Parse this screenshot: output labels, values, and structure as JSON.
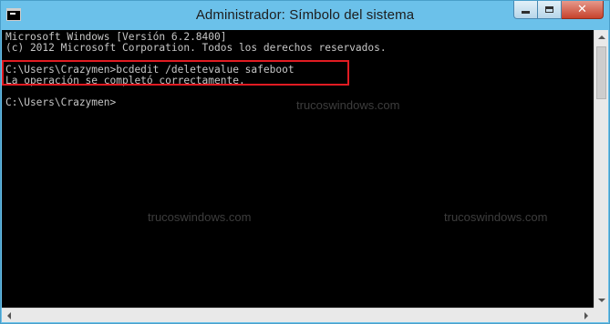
{
  "window": {
    "title": "Administrador: Símbolo del sistema",
    "app_icon": "cmd-icon",
    "controls": {
      "minimize_icon": "minimize-icon",
      "maximize_icon": "maximize-icon",
      "close_label": "✕"
    }
  },
  "console": {
    "lines": [
      "Microsoft Windows [Versión 6.2.8400]",
      "(c) 2012 Microsoft Corporation. Todos los derechos reservados.",
      "",
      "C:\\Users\\Crazymen>bcdedit /deletevalue safeboot",
      "La operación se completó correctamente.",
      "",
      "C:\\Users\\Crazymen>"
    ],
    "watermarks": [
      "trucoswindows.com",
      "trucoswindows.com",
      "trucoswindows.com"
    ]
  },
  "colors": {
    "titlebar": "#6bc1ea",
    "console_bg": "#000000",
    "console_text": "#c6c6c6",
    "highlight": "#e11b22",
    "close_button": "#c7432d"
  }
}
